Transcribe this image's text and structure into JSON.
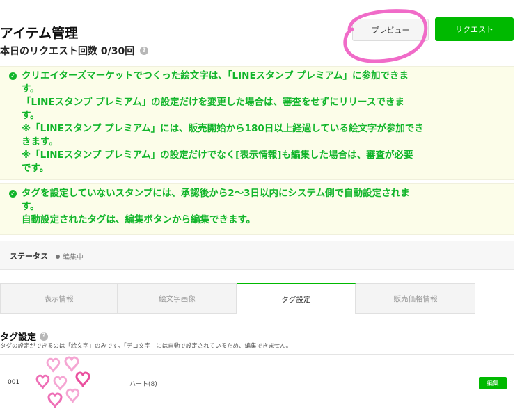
{
  "header": {
    "title": "アイテム管理",
    "request_count": "本日のリクエスト回数 0/30回",
    "help_glyph": "?",
    "preview_label": "プレビュー",
    "request_label": "リクエスト"
  },
  "notices": [
    {
      "lines": [
        "クリエイターズマーケットでつくった絵文字は、「LINEスタンプ プレミアム」に参加できま",
        "す。",
        "「LINEスタンプ プレミアム」の設定だけを変更した場合は、審査をせずにリリースできま",
        "す。",
        "※「LINEスタンプ プレミアム」には、販売開始から180日以上経過している絵文字が参加でき",
        "きます。",
        "※「LINEスタンプ プレミアム」の設定だけでなく[表示情報]も編集した場合は、審査が必要",
        "です。"
      ]
    },
    {
      "lines": [
        "タグを設定していないスタンプには、承認後から2〜3日以内にシステム側で自動設定されま",
        "す。",
        "自動設定されたタグは、編集ボタンから編集できます。"
      ]
    }
  ],
  "status": {
    "label": "ステータス",
    "value": "編集中"
  },
  "tabs": [
    {
      "label": "表示情報"
    },
    {
      "label": "絵文字画像"
    },
    {
      "label": "タグ設定"
    },
    {
      "label": "販売価格情報"
    }
  ],
  "tag_section": {
    "title": "タグ設定",
    "description": "タグの設定ができるのは「絵文字」のみです。「デコ文字」には自動で設定されているため、編集できません。",
    "rows": [
      {
        "number": "001",
        "tag": "ハート(8)",
        "edit_label": "編集"
      }
    ]
  },
  "colors": {
    "brand_green": "#00b900",
    "notice_text": "#11b52a",
    "annotation_pink": "#f06bc8",
    "heart_pink": "#f7a8d8"
  },
  "icons": {
    "check": "check-circle-icon",
    "help": "question-circle-icon",
    "hearts": "hearts-emoji-icon"
  }
}
